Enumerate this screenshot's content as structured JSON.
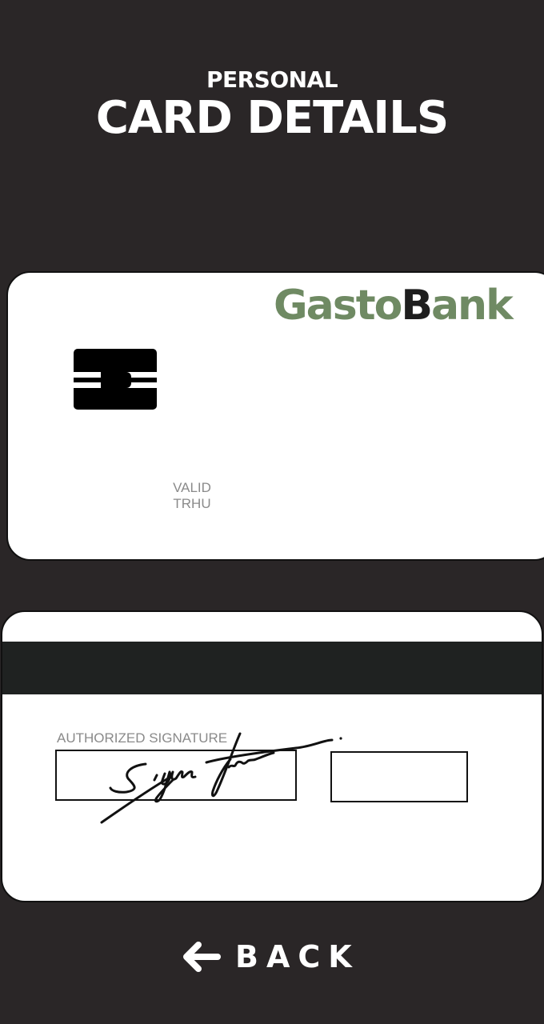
{
  "header": {
    "subtitle": "PERSONAL",
    "title": "CARD DETAILS"
  },
  "card_front": {
    "brand_part1": "Gasto",
    "brand_part2": "Bank",
    "brand_color": "#6f8a63",
    "brand_dark": "#1e1e1e",
    "valid_line1": "VALID",
    "valid_line2": "TRHU",
    "chip_icon": "chip-icon"
  },
  "card_back": {
    "signature_label": "AUTHORIZED SIGNATURE",
    "stripe_color": "#1f2221"
  },
  "back_button": {
    "label": "BACK",
    "icon": "arrow-left-icon"
  },
  "colors": {
    "background": "#2a2627",
    "card": "#ffffff"
  }
}
